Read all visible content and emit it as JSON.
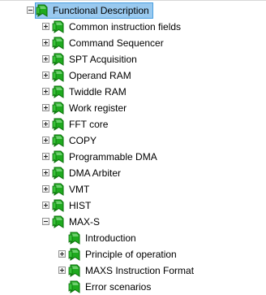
{
  "tree": {
    "root": {
      "label": "Functional Description",
      "expanded": true,
      "selected": true
    },
    "children": [
      {
        "label": "Common instruction fields",
        "expanded": false
      },
      {
        "label": "Command Sequencer",
        "expanded": false
      },
      {
        "label": "SPT Acquisition",
        "expanded": false
      },
      {
        "label": "Operand RAM",
        "expanded": false
      },
      {
        "label": "Twiddle RAM",
        "expanded": false
      },
      {
        "label": "Work register",
        "expanded": false
      },
      {
        "label": "FFT core",
        "expanded": false
      },
      {
        "label": "COPY",
        "expanded": false
      },
      {
        "label": "Programmable DMA",
        "expanded": false
      },
      {
        "label": "DMA Arbiter",
        "expanded": false
      },
      {
        "label": "VMT",
        "expanded": false
      },
      {
        "label": "HIST",
        "expanded": false
      },
      {
        "label": "MAX-S",
        "expanded": true,
        "children": [
          {
            "label": "Introduction",
            "has_children": false
          },
          {
            "label": "Principle of operation",
            "expanded": false,
            "has_children": true
          },
          {
            "label": "MAXS Instruction Format",
            "expanded": false,
            "has_children": true
          },
          {
            "label": "Error scenarios",
            "has_children": false
          }
        ]
      }
    ]
  },
  "icons": {
    "node_icon": "green-bookmark-icon",
    "icon_green": "#1faa1f",
    "icon_dark_green": "#0a6e0a"
  },
  "colors": {
    "selection_bg": "#99c9ef",
    "selection_border": "#4a9fe0"
  }
}
